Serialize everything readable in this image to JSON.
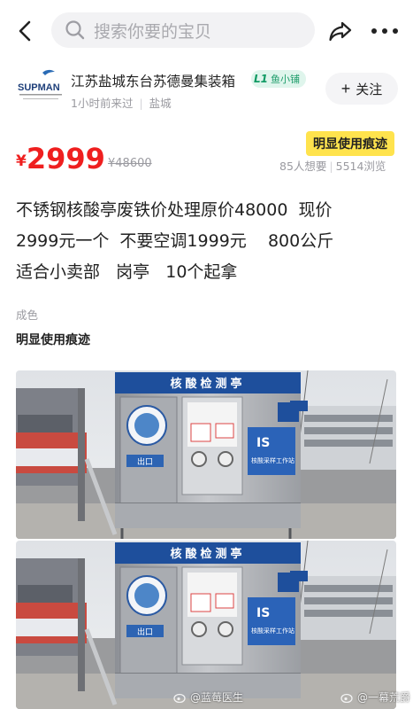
{
  "search": {
    "placeholder": "搜索你要的宝贝"
  },
  "shop": {
    "logo_text": "SUPMAN",
    "name": "江苏盐城东台苏德曼集装箱",
    "badge_level": "L1",
    "badge_label": "鱼小铺",
    "last_seen": "1小时前来过",
    "location": "盐城",
    "follow_label": "关注"
  },
  "listing": {
    "condition_tag": "明显使用痕迹",
    "price_symbol": "¥",
    "price": "2999",
    "original_price": "¥48600",
    "wants": "85人想要",
    "views": "5514浏览",
    "description_lines": [
      "不锈钢核酸亭废铁价处理原价48000  现价",
      "2999元一个  不要空调1999元    800公斤",
      "适合小卖部   岗亭   10个起拿"
    ],
    "condition_label": "成色",
    "condition_value": "明显使用痕迹"
  },
  "photos": [
    {
      "booth_sign": "核酸检测亭",
      "exit_label": "出口",
      "poster_text": "核酸采样工作站",
      "poster_logo": "IS"
    },
    {
      "booth_sign": "核酸检测亭",
      "exit_label": "出口",
      "poster_text": "核酸采样工作站",
      "poster_logo": "IS"
    }
  ],
  "watermarks": [
    "@蓝莓医生",
    "@一幕荒爵"
  ],
  "colors": {
    "price_red": "#ef1f1f",
    "tag_yellow": "#ffe34d",
    "badge_green": "#1f9d6b",
    "booth_blue": "#1e4f9c"
  }
}
